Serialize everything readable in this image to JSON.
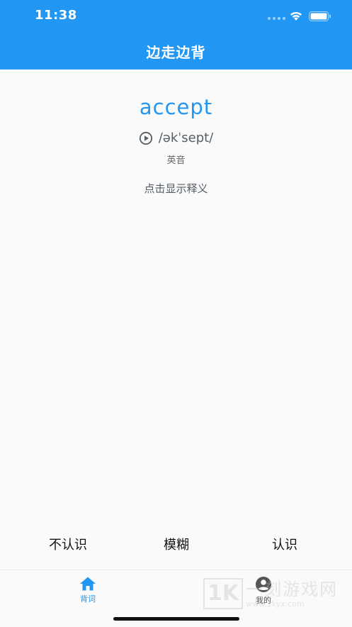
{
  "status_bar": {
    "time": "11:38"
  },
  "header": {
    "title": "边走边背"
  },
  "card": {
    "word": "accept",
    "phonetic": "/əkˈsept/",
    "accent": "英音",
    "reveal_hint": "点击显示释义"
  },
  "answers": {
    "unknown": "不认识",
    "vague": "模糊",
    "known": "认识"
  },
  "tabs": [
    {
      "label": "背词",
      "icon": "home-icon",
      "active": true
    },
    {
      "label": "我的",
      "icon": "account-icon",
      "active": false
    }
  ],
  "watermark": {
    "cn": "一刻游戏网",
    "url": "www.1kyx.com"
  },
  "colors": {
    "primary": "#2196f3",
    "background": "#fafafa"
  }
}
